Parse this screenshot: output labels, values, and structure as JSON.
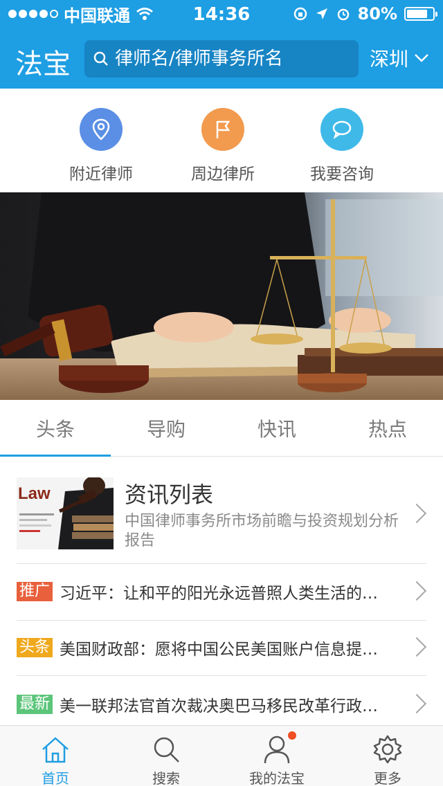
{
  "status_bar": {
    "carrier": "中国联通",
    "time": "14:36",
    "battery": "80%",
    "battery_level": 0.8
  },
  "header": {
    "logo": "法宝",
    "search_placeholder": "律师名/律师事务所名",
    "city": "深圳"
  },
  "quick_actions": [
    {
      "label": "附近律师",
      "icon": "location-pin-icon",
      "color": "#5b8fe5"
    },
    {
      "label": "周边律所",
      "icon": "flag-icon",
      "color": "#f29a4d"
    },
    {
      "label": "我要咨询",
      "icon": "chat-bubble-icon",
      "color": "#3fb9e8"
    }
  ],
  "banner": {
    "icon": "justice-scale-gavel-image"
  },
  "tabs": [
    "头条",
    "导购",
    "快讯",
    "热点"
  ],
  "active_tab": 0,
  "feature": {
    "title": "资讯列表",
    "description": "中国律师事务所市场前瞻与投资规划分析报告",
    "thumb_text": "Law"
  },
  "news": [
    {
      "badge": "推广",
      "badge_color": "#e8603c",
      "text": "习近平：让和平的阳光永远普照人类生活的…"
    },
    {
      "badge": "头条",
      "badge_color": "#f0a81d",
      "text": "美国财政部：愿将中国公民美国账户信息提…"
    },
    {
      "badge": "最新",
      "badge_color": "#5cc57a",
      "text": "美一联邦法官首次裁决奥巴马移民改革行政…"
    }
  ],
  "tab_bar": [
    {
      "label": "首页",
      "icon": "home-icon"
    },
    {
      "label": "搜索",
      "icon": "search-icon"
    },
    {
      "label": "我的法宝",
      "icon": "user-icon"
    },
    {
      "label": "更多",
      "icon": "gear-icon"
    }
  ],
  "colors": {
    "brand": "#1e9ee3"
  }
}
